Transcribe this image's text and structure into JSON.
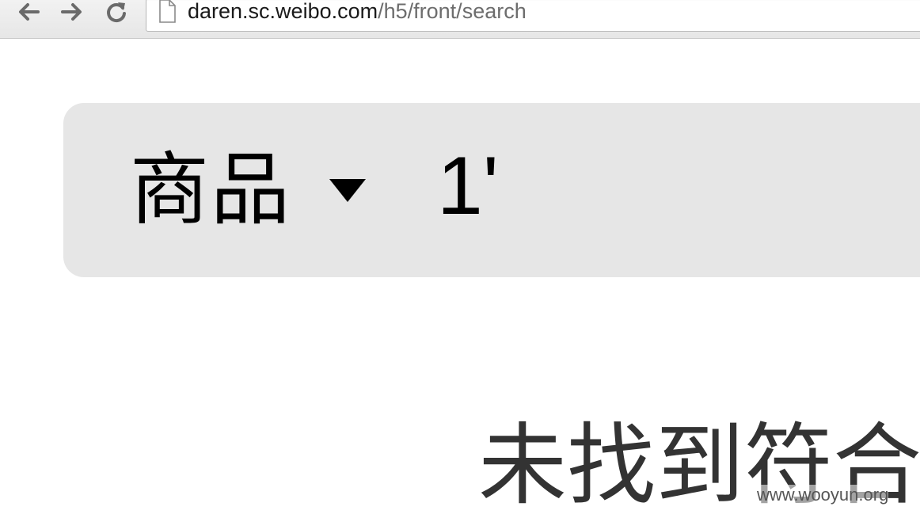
{
  "browser": {
    "url_host": "daren.sc.weibo.com",
    "url_path": "/h5/front/search",
    "nav_icons": [
      "back-arrow-icon",
      "forward-arrow-icon",
      "reload-icon"
    ],
    "page_icon": "document-icon"
  },
  "search": {
    "category_label": "商品",
    "dropdown_icon": "triangle-down-icon",
    "query_value": "1'"
  },
  "results": {
    "empty_message": "未找到符合"
  },
  "watermark": {
    "text": "www.wooyun.org"
  },
  "colors": {
    "panel_background": "#e6e6e6",
    "message_text": "#333333"
  }
}
